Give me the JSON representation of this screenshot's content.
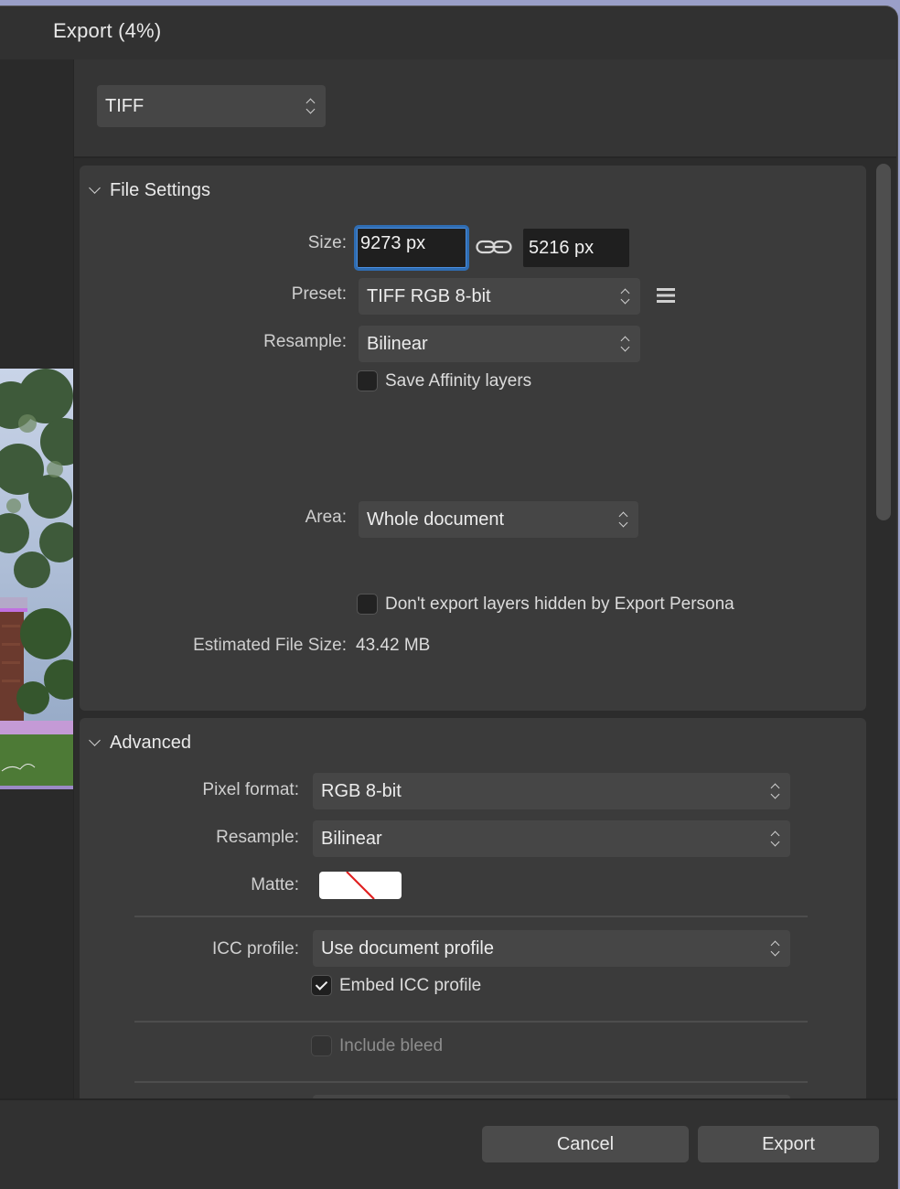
{
  "window": {
    "title": "Export (4%)"
  },
  "format": {
    "selected": "TIFF"
  },
  "file_settings": {
    "header": "File Settings",
    "size_label": "Size:",
    "width_value": "9273 px",
    "height_value": "5216 px",
    "preset_label": "Preset:",
    "preset_value": "TIFF RGB 8-bit",
    "resample_label": "Resample:",
    "resample_value": "Bilinear",
    "save_layers_label": "Save Affinity layers",
    "save_layers_checked": false,
    "area_label": "Area:",
    "area_value": "Whole document",
    "hidden_layers_label": "Don't export layers hidden by Export Persona",
    "hidden_layers_checked": false,
    "estimated_label": "Estimated File Size:",
    "estimated_value": "43.42 MB"
  },
  "advanced": {
    "header": "Advanced",
    "pixel_format_label": "Pixel format:",
    "pixel_format_value": "RGB 8-bit",
    "resample_label": "Resample:",
    "resample_value": "Bilinear",
    "matte_label": "Matte:",
    "icc_label": "ICC profile:",
    "icc_value": "Use document profile",
    "embed_icc_label": "Embed ICC profile",
    "embed_icc_checked": true,
    "include_bleed_label": "Include bleed",
    "include_bleed_checked": false
  },
  "footer": {
    "cancel_label": "Cancel",
    "export_label": "Export"
  },
  "colors": {
    "accent_focus": "#2f6db3",
    "window_bg": "#313131",
    "panel_bg": "#3b3b3b"
  },
  "icons": {
    "link": "chain-link-icon",
    "menu": "hamburger-menu-icon",
    "stepper": "up-down-chevron-icon"
  }
}
